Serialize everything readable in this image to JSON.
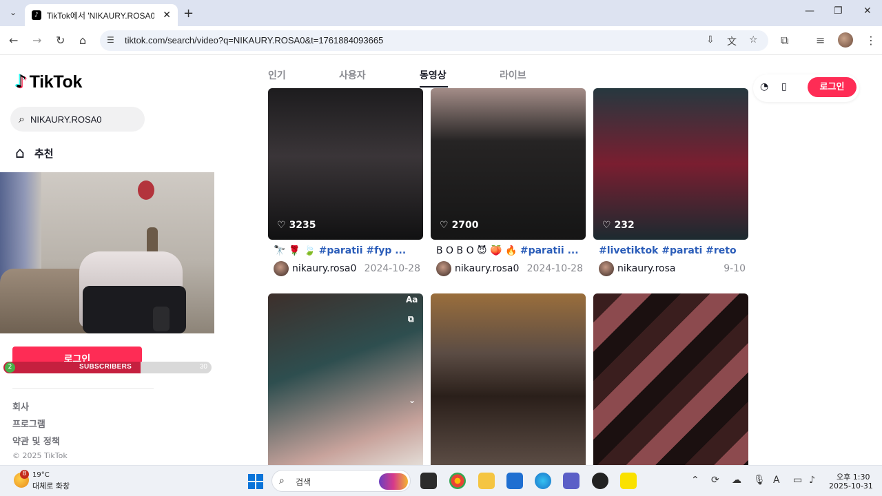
{
  "browser": {
    "tab_title": "TikTok에서 'NIKAURY.ROSA0' 동영상",
    "url": "tiktok.com/search/video?q=NIKAURY.ROSA0&t=1761884093665"
  },
  "sidebar": {
    "logo_text": "TikTok",
    "search_value": "NIKAURY.ROSA0",
    "recommend_label": "추천",
    "login_label": "로그인",
    "subs_widget": {
      "current": "2",
      "label": "SUBSCRIBERS",
      "goal": "30",
      "progress": 0.067
    },
    "footer_links": [
      "회사",
      "프로그램",
      "약관 및 정책"
    ],
    "copyright": "© 2025 TikTok"
  },
  "search_tabs": [
    {
      "label": "인기",
      "active": false
    },
    {
      "label": "사용자",
      "active": false
    },
    {
      "label": "동영상",
      "active": true
    },
    {
      "label": "라이브",
      "active": false
    }
  ],
  "top_right": {
    "login_label": "로그인"
  },
  "videos": [
    {
      "likes": "3235",
      "desc_prefix": "🔭 🌹 🍃 ",
      "desc_tags": "#paratii #fyp ...",
      "user": "nikaury.rosa0",
      "date": "2024-10-28",
      "colors": [
        "#1d1c1e",
        "#3a3538",
        "#111112"
      ]
    },
    {
      "likes": "2700",
      "desc_prefix": "B O B O 😈 🍑 🔥 ",
      "desc_tags": "#paratii ...",
      "user": "nikaury.rosa0",
      "date": "2024-10-28",
      "colors": [
        "#a48d88",
        "#262424",
        "#151515"
      ]
    },
    {
      "likes": "232",
      "desc_prefix": "",
      "desc_tags": "#livetiktok #parati #reto",
      "user": "nikaury.rosa",
      "date": "9-10",
      "colors": [
        "#26383f",
        "#7a1e30",
        "#1c2a30"
      ]
    },
    {
      "likes": "",
      "colors": [
        "#3d2f2b",
        "#2e4e4f",
        "#c8a39c"
      ],
      "side_label": "Aa"
    },
    {
      "likes": "",
      "colors": [
        "#9a6e3c",
        "#2a1f1a",
        "#5b4c44"
      ]
    },
    {
      "likes": "",
      "colors": [
        "#3a1e1e",
        "#8c4a4e",
        "#1b1010"
      ]
    }
  ],
  "taskbar": {
    "weather_badge": "8",
    "temperature": "19°C",
    "weather_desc": "대체로 화창",
    "search_placeholder": "검색",
    "time": "오후 1:30",
    "date": "2025-10-31"
  }
}
